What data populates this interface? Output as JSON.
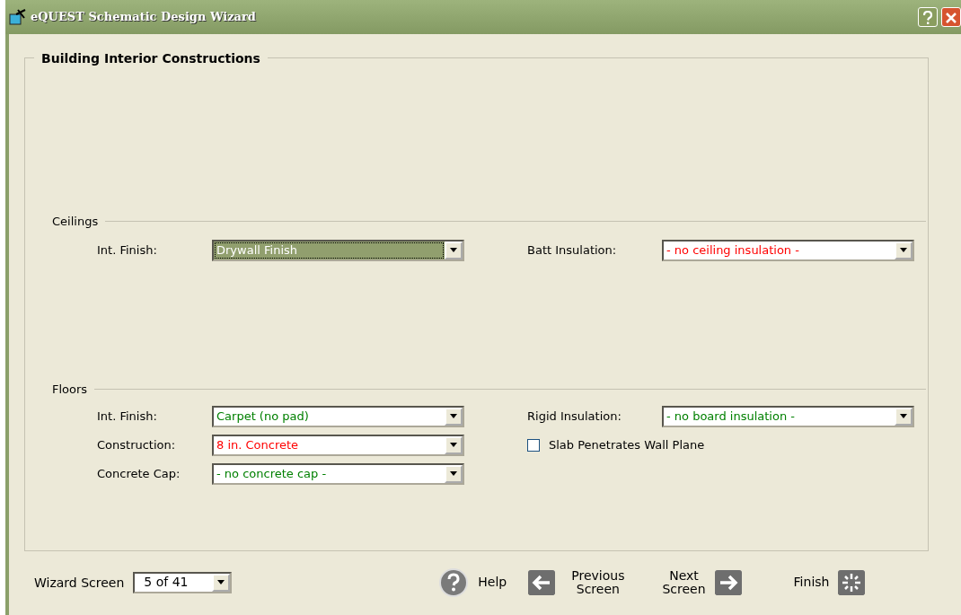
{
  "window": {
    "title": "eQUEST Schematic Design Wizard"
  },
  "panel": {
    "title": "Building Interior Constructions"
  },
  "sections": [
    {
      "title": "Ceilings",
      "left": [
        {
          "label": "Int. Finish:",
          "value": "Drywall Finish",
          "color": "#ffffff",
          "focused": true
        }
      ],
      "right": [
        {
          "kind": "dropdown",
          "label": "Batt Insulation:",
          "value": "- no ceiling insulation -",
          "color": "#ff0000",
          "focused": false
        }
      ]
    },
    {
      "title": "Floors",
      "left": [
        {
          "label": "Int. Finish:",
          "value": "Carpet (no pad)",
          "color": "#008000",
          "focused": false
        },
        {
          "label": "Construction:",
          "value": "8 in. Concrete",
          "color": "#ff0000",
          "focused": false
        },
        {
          "label": "Concrete Cap:",
          "value": "- no concrete cap -",
          "color": "#008000",
          "focused": false
        }
      ],
      "right": [
        {
          "kind": "dropdown",
          "label": "Rigid Insulation:",
          "value": "- no board insulation -",
          "color": "#008000",
          "focused": false
        },
        {
          "kind": "checkbox",
          "label": "Slab Penetrates Wall Plane",
          "checked": false
        }
      ]
    }
  ],
  "footer": {
    "screen_label": "Wizard Screen",
    "screen_value": "5 of 41",
    "help": "Help",
    "previous": [
      "Previous",
      "Screen"
    ],
    "next": [
      "Next",
      "Screen"
    ],
    "finish": "Finish"
  }
}
